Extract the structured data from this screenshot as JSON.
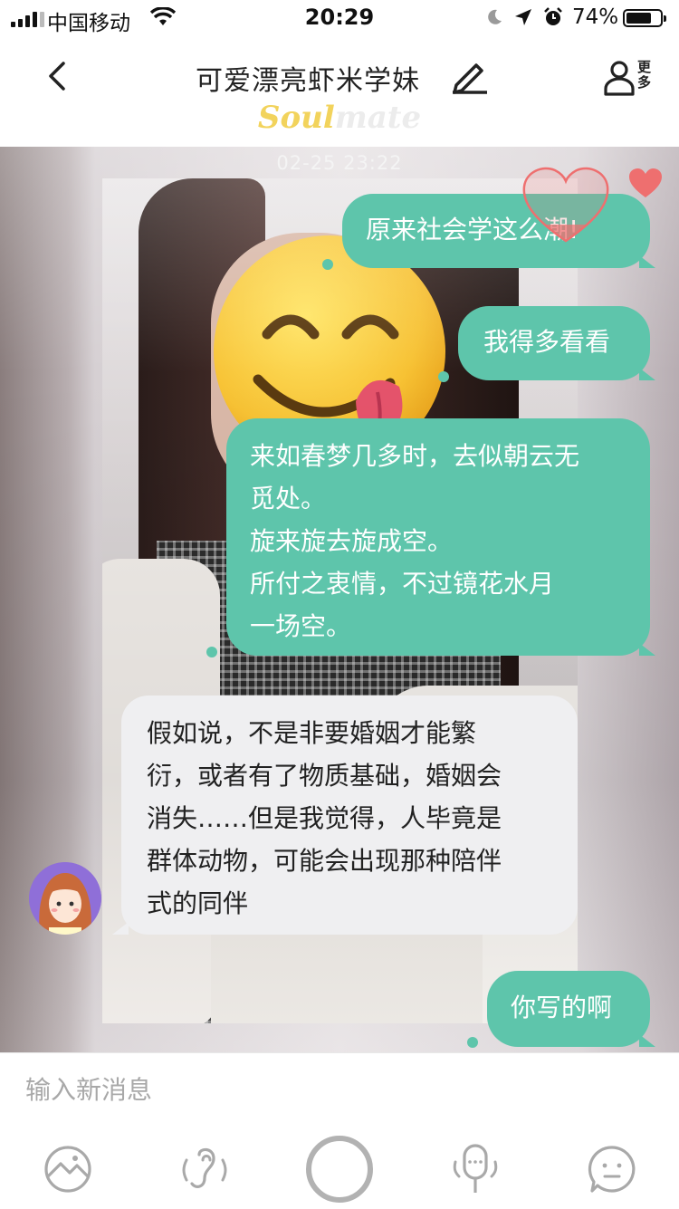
{
  "status_bar": {
    "carrier": "中国移动",
    "time": "20:29",
    "battery_percent": "74%",
    "battery_level": 0.74,
    "icons": [
      "signal-icon",
      "wifi-icon",
      "moon-icon",
      "location-icon",
      "alarm-icon",
      "battery-icon"
    ]
  },
  "header": {
    "title": "可爱漂亮虾米学妹",
    "more_label": "更多",
    "brand_soul": "Soul",
    "brand_mate": "mate",
    "icons": [
      "back-chevron-icon",
      "edit-pencil-icon",
      "profile-more-icon"
    ]
  },
  "chat": {
    "timestamp": "02-25 23:22",
    "messages": [
      {
        "direction": "out",
        "text": "原来社会学这么潮!"
      },
      {
        "direction": "out",
        "text": "我得多看看"
      },
      {
        "direction": "out",
        "lines": [
          "来如春梦几多时，去似朝云无",
          "觅处。",
          "旋来旋去旋成空。",
          "所付之衷情，不过镜花水月",
          "一场空。"
        ]
      },
      {
        "direction": "in",
        "lines": [
          "假如说，不是非要婚姻才能繁",
          "衍，或者有了物质基础，婚姻会",
          "消失……但是我觉得，人毕竟是",
          "群体动物，可能会出现那种陪伴",
          "式的同伴"
        ]
      },
      {
        "direction": "out",
        "text": "你写的啊"
      }
    ],
    "icons": [
      "heart-outline-icon",
      "heart-like-icon",
      "avatar-girl-icon",
      "emoji-tongue-icon"
    ]
  },
  "input": {
    "placeholder": "输入新消息",
    "tools": [
      "image-icon",
      "voice-changer-icon",
      "record-button-icon",
      "mic-icon",
      "emoji-icon"
    ]
  },
  "colors": {
    "bubble_out": "#5ec5ab",
    "bubble_in": "#efeff1",
    "heart": "#ee6f6f",
    "brand_soul": "#f2d35c"
  }
}
